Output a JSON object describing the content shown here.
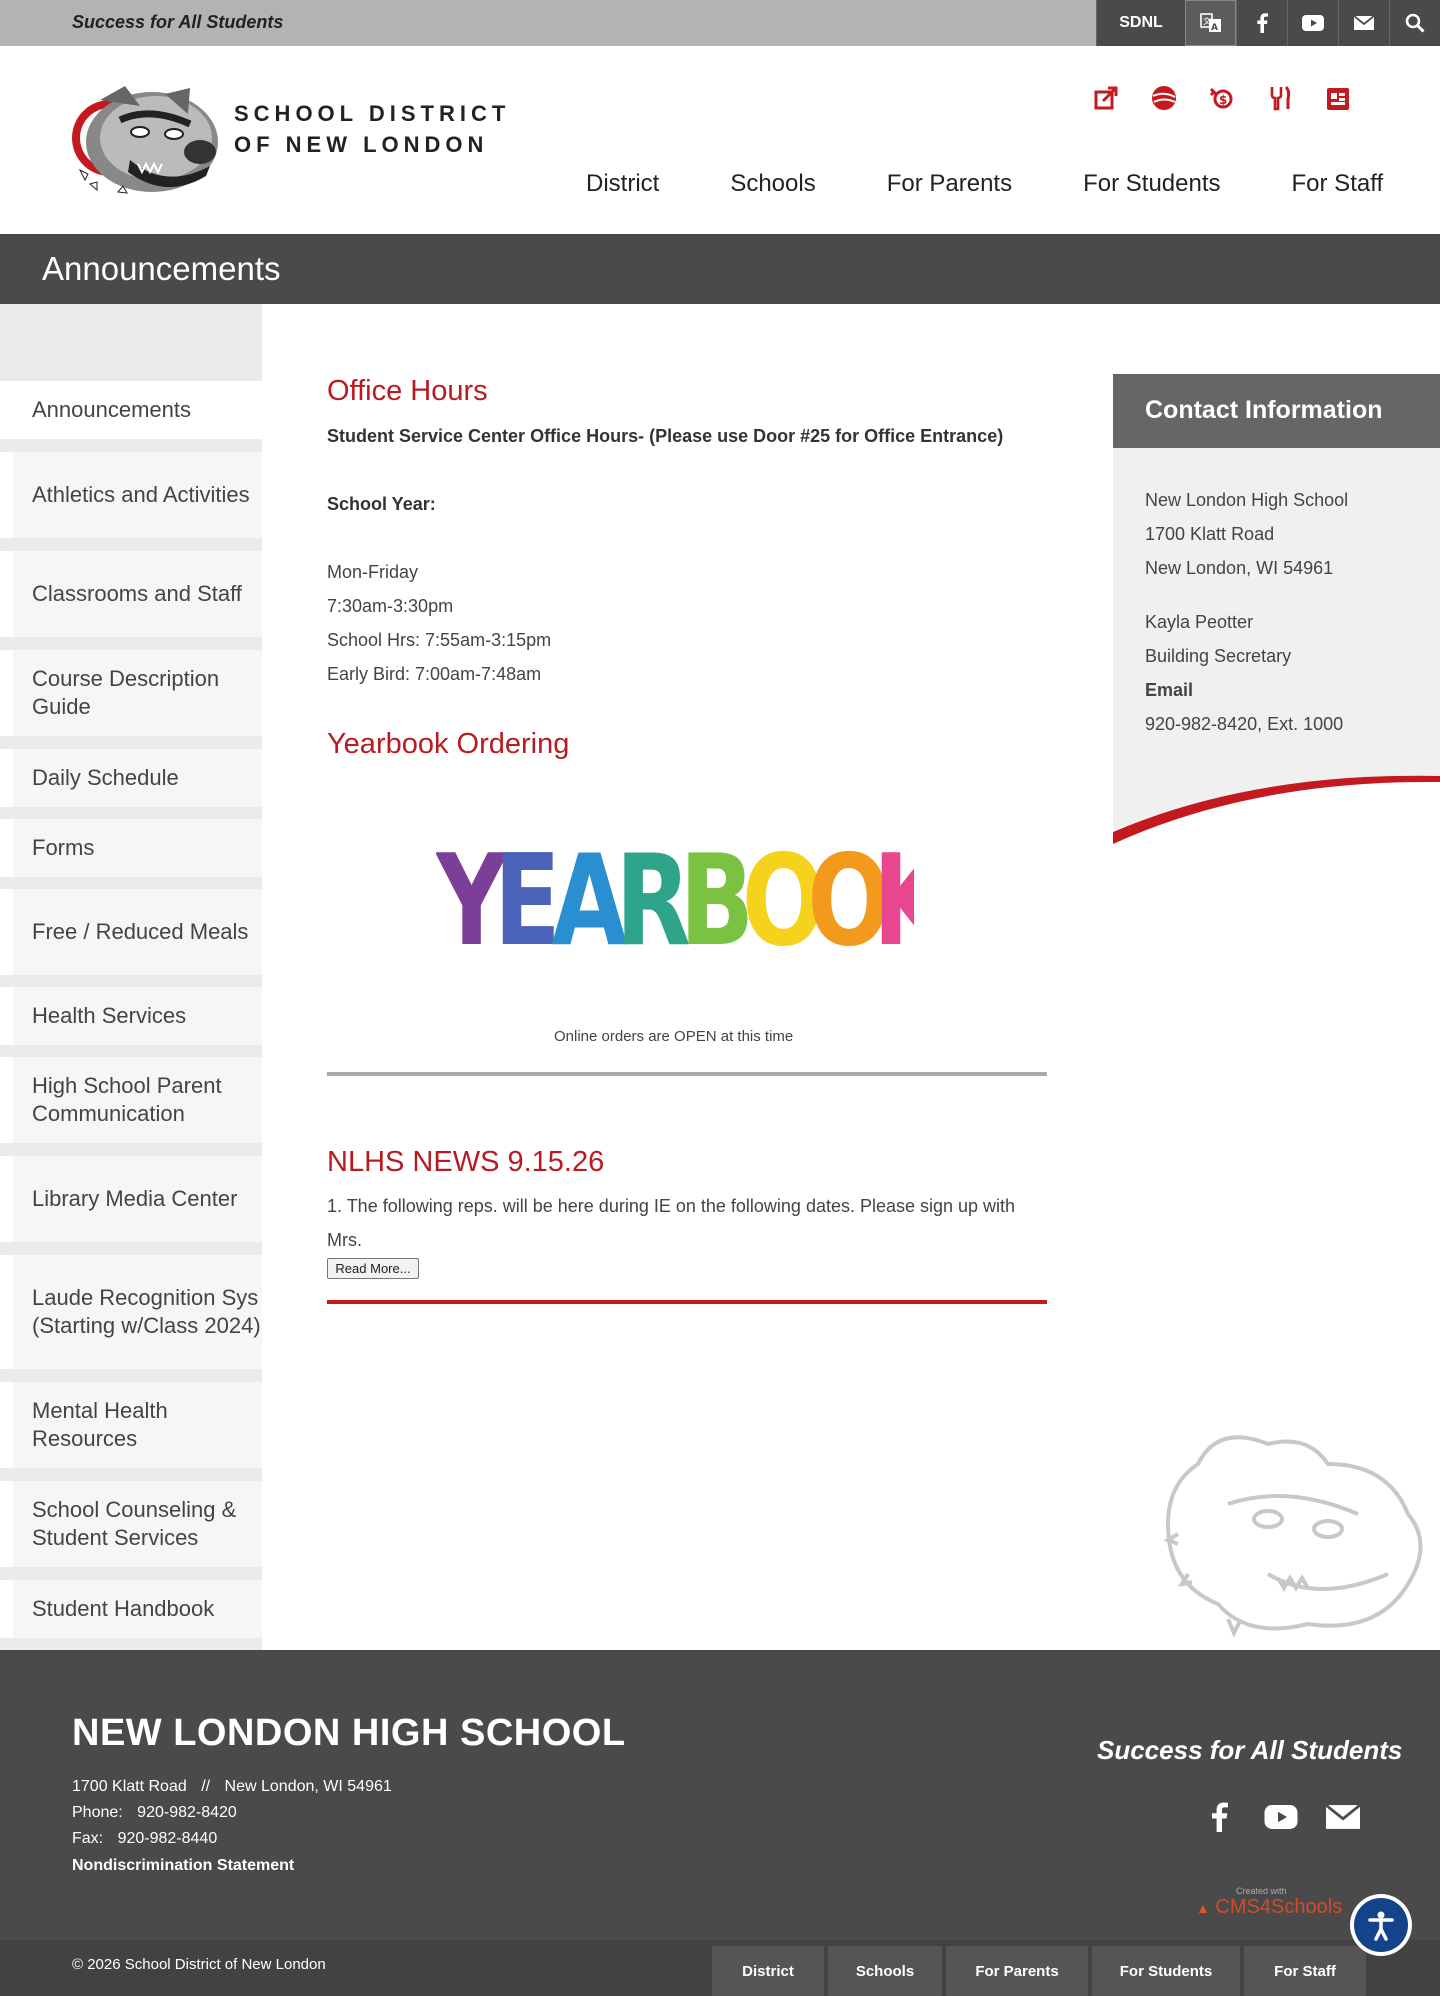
{
  "topbar": {
    "tagline": "Success for All Students",
    "sdnl_label": "SDNL",
    "icons": [
      "translate-icon",
      "facebook-icon",
      "youtube-icon",
      "mail-icon",
      "search-icon"
    ]
  },
  "header": {
    "district_name_line1": "SCHOOL DISTRICT",
    "district_name_line2": "OF NEW LONDON",
    "quick_icons": [
      "external-link-icon",
      "sports-ball-icon",
      "payment-icon",
      "food-menu-icon",
      "calendar-icon"
    ],
    "nav": [
      "District",
      "Schools",
      "For Parents",
      "For Students",
      "For Staff"
    ]
  },
  "banner": {
    "title": "Announcements"
  },
  "sidebar": {
    "items": [
      "Announcements",
      "Athletics and Activities",
      "Classrooms and Staff",
      "Course Description Guide",
      "Daily Schedule",
      "Forms",
      "Free / Reduced Meals",
      "Health Services",
      "High School Parent Communication",
      "Library Media Center",
      "Laude Recognition Sys (Starting w/Class 2024)",
      "Mental Health Resources",
      "School Counseling & Student Services",
      "Student Handbook"
    ]
  },
  "main": {
    "office": {
      "title": "Office Hours",
      "subtitle": "Student Service Center Office Hours- (Please use Door #25 for Office Entrance)",
      "school_year": "School Year:",
      "lines": [
        "Mon-Friday",
        "7:30am-3:30pm",
        "School Hrs:  7:55am-3:15pm",
        "Early Bird:  7:00am-7:48am"
      ]
    },
    "yearbook": {
      "title": "Yearbook Ordering",
      "image_word": "YEARBOOK",
      "caption": "Online orders are OPEN at this time"
    },
    "news": {
      "title": "NLHS NEWS 9.15.26",
      "excerpt_line1": "1. The following reps. will be here during IE on the following dates. Please sign up with",
      "excerpt_line2": "Mrs.",
      "read_more": "Read More..."
    }
  },
  "contact": {
    "title": "Contact Information",
    "school": "New London High School",
    "street": "1700 Klatt Road",
    "city": "New London, WI 54961",
    "person": "Kayla Peotter",
    "role": "Building Secretary",
    "email_label": "Email",
    "phone": "920-982-8420, Ext. 1000"
  },
  "footer": {
    "school_name": "NEW LONDON HIGH SCHOOL",
    "address": "1700 Klatt Road",
    "separator": "//",
    "city": "New London, WI 54961",
    "phone_label": "Phone:",
    "phone": "920-982-8420",
    "fax_label": "Fax:",
    "fax": "920-982-8440",
    "nondiscrimination": "Nondiscrimination Statement",
    "tagline": "Success for All Students",
    "cms_small": "Created with",
    "cms_brand": "CMS4Schools",
    "copyright": "© 2026 School District of New London",
    "nav": [
      "District",
      "Schools",
      "For Parents",
      "For Students",
      "For Staff"
    ]
  },
  "colors": {
    "accent_red": "#b81c22",
    "dark_gray": "#4a4a4a",
    "top_gray": "#b3b3b3"
  }
}
